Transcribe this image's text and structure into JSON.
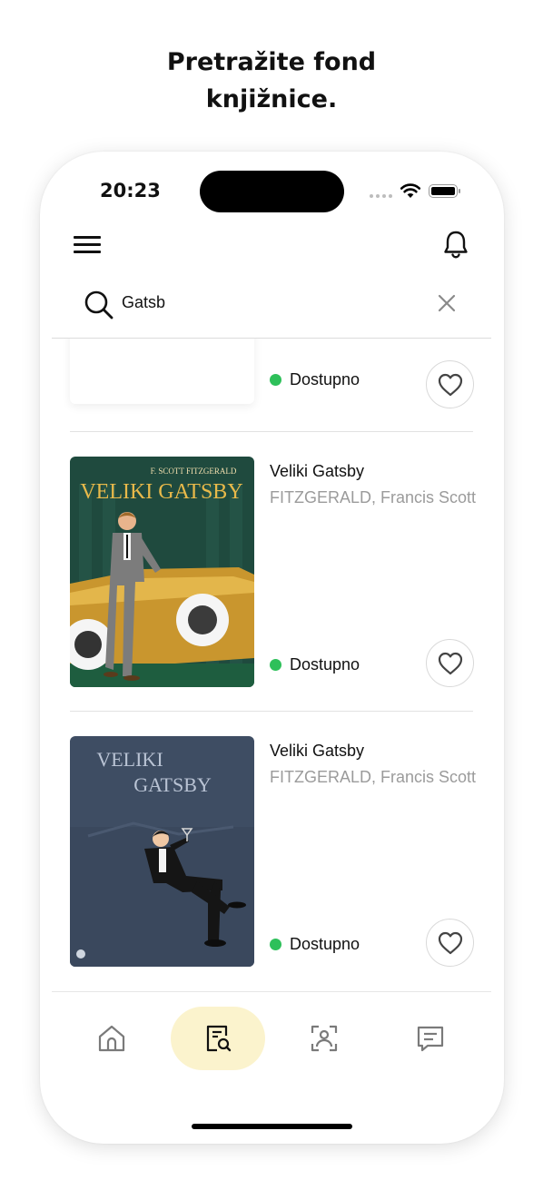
{
  "headline": {
    "line1": "Pretražite fond",
    "line2": "knjižnice."
  },
  "status_bar": {
    "time": "20:23",
    "battery_level": 1.0
  },
  "header": {
    "menu_icon": "hamburger-menu-icon",
    "notification_icon": "bell-icon"
  },
  "search": {
    "value": "Gatsb",
    "placeholder": "",
    "search_icon": "search-icon",
    "clear_icon": "close-icon"
  },
  "results": [
    {
      "title": "",
      "author": "",
      "availability": "Dostupno",
      "availability_color": "#2ec05a",
      "cover": "placeholder"
    },
    {
      "title": "Veliki Gatsby",
      "author": "FITZGERALD, Francis Scott",
      "availability": "Dostupno",
      "availability_color": "#2ec05a",
      "cover": "art-deco-car",
      "cover_text": {
        "author": "F. SCOTT FITZGERALD",
        "title": "VELIKI GATSBY"
      }
    },
    {
      "title": "Veliki Gatsby",
      "author": "FITZGERALD, Francis Scott",
      "availability": "Dostupno",
      "availability_color": "#2ec05a",
      "cover": "man-with-martini",
      "cover_text": {
        "title_line1": "VELIKI",
        "title_line2": "GATSBY"
      }
    }
  ],
  "tab_bar": {
    "active_tab": "search",
    "active_color": "#fbf3cd",
    "tabs": [
      {
        "id": "home",
        "icon": "home-icon"
      },
      {
        "id": "search",
        "icon": "book-search-icon"
      },
      {
        "id": "scan",
        "icon": "face-scan-icon"
      },
      {
        "id": "messages",
        "icon": "chat-icon"
      }
    ]
  }
}
